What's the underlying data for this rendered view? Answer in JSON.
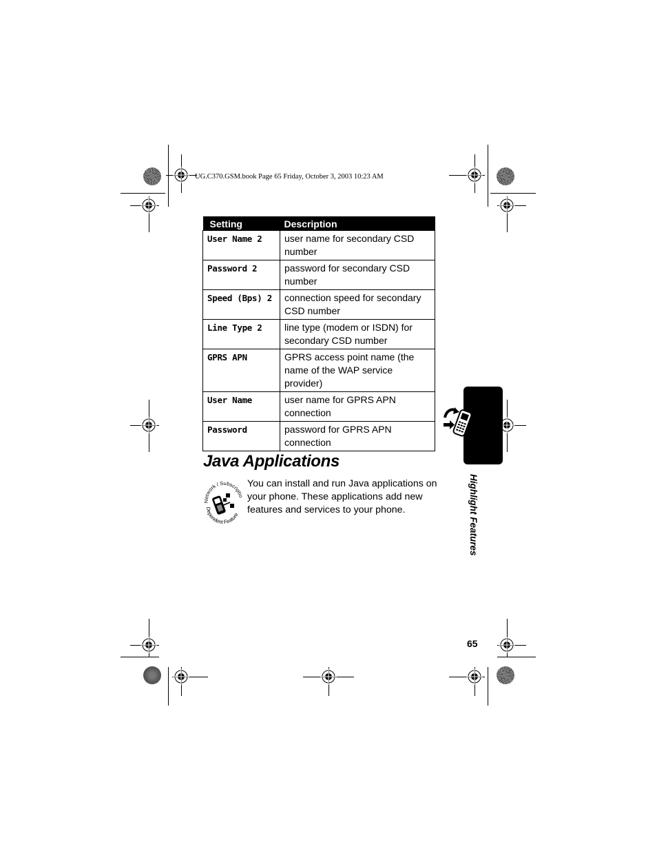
{
  "header": {
    "print_info": "UG.C370.GSM.book  Page 65  Friday, October 3, 2003  10:23 AM"
  },
  "table": {
    "columns": [
      "Setting",
      "Description"
    ],
    "rows": [
      {
        "setting": "User Name 2",
        "description": "user name for secondary CSD number"
      },
      {
        "setting": "Password 2",
        "description": "password for secondary CSD number"
      },
      {
        "setting": "Speed (Bps) 2",
        "description": "connection speed for secondary CSD number"
      },
      {
        "setting": "Line Type 2",
        "description": "line type (modem or ISDN) for secondary CSD number"
      },
      {
        "setting": "GPRS APN",
        "description": "GPRS access point name (the name of the WAP service provider)"
      },
      {
        "setting": "User Name",
        "description": "user name for GPRS APN connection"
      },
      {
        "setting": "Password",
        "description": "password for GPRS APN connection"
      }
    ]
  },
  "section": {
    "title": "Java Applications",
    "icon": "network-subscription-dependent-feature-icon",
    "icon_text_top": "Network / Subscription",
    "icon_text_bottom": "Dependent Feature",
    "body": "You can install and run Java applications on your phone. These applications add new features and services to your phone."
  },
  "side_tab": {
    "icon": "phone-arrows-icon",
    "label": "Highlight Features"
  },
  "footer": {
    "page_number": "65"
  }
}
